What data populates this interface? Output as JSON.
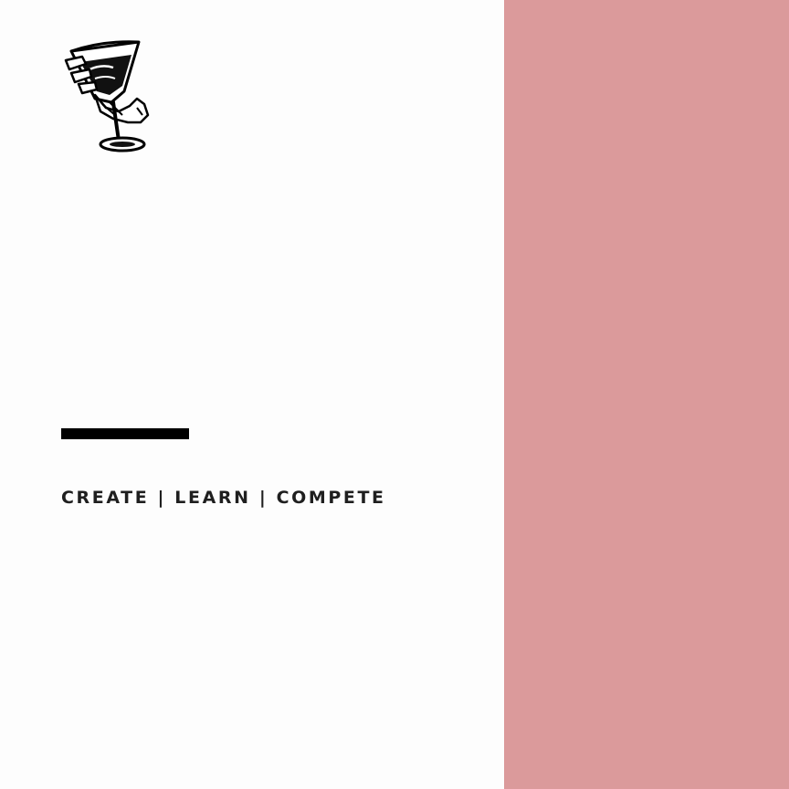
{
  "colors": {
    "background": "#fdfdfd",
    "accent_panel": "#db9a9b",
    "rule": "#000000",
    "text": "#1f1f1f"
  },
  "logo": {
    "icon": "skeleton-hand-martini-glass-icon"
  },
  "tagline": {
    "text": "CREATE | LEARN | COMPETE"
  }
}
